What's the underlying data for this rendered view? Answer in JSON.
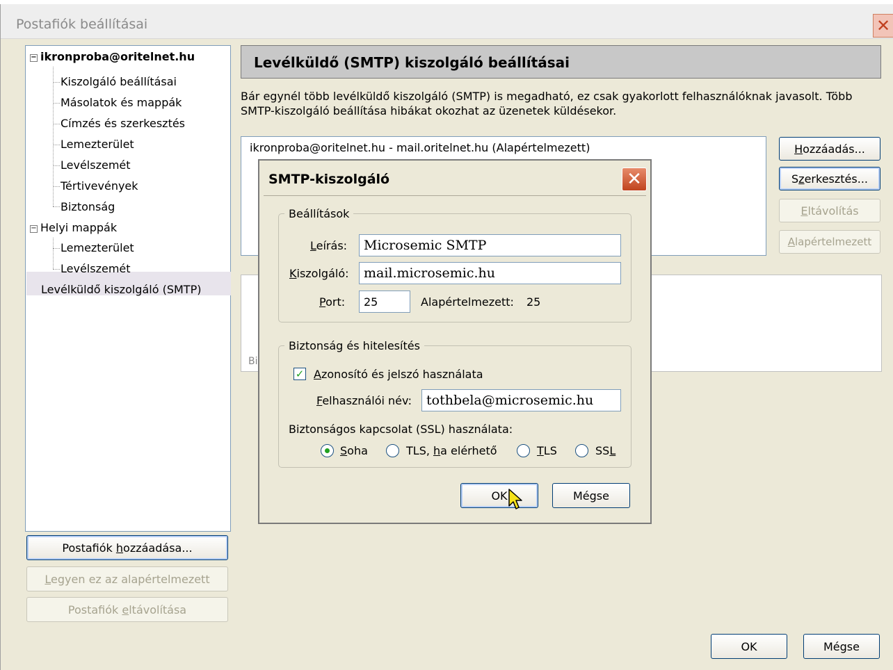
{
  "window": {
    "title": "Postafiók beállításai",
    "close_glyph": "✕"
  },
  "tree": {
    "account1": {
      "label": "ikronproba@oritelnet.hu",
      "items": [
        "Kiszolgáló beállításai",
        "Másolatok és mappák",
        "Címzés és szerkesztés",
        "Lemezterület",
        "Levélszemét",
        "Tértivevények",
        "Biztonság"
      ]
    },
    "account2": {
      "label": "Helyi mappák",
      "items": [
        "Lemezterület",
        "Levélszemét"
      ]
    },
    "smtp_item": "Levélküldő kiszolgáló (SMTP)",
    "expander_glyph": "−"
  },
  "left_buttons": {
    "add_account": {
      "pre": "Postafiók ",
      "key": "h",
      "post": "ozzáadása..."
    },
    "set_default": {
      "pre": "",
      "key": "L",
      "post": "egyen ez az alapértelmezett"
    },
    "remove_account": {
      "pre": "Postafiók ",
      "key": "e",
      "post": "ltávolítása"
    }
  },
  "panel": {
    "heading": "Levélküldő (SMTP) kiszolgáló beállításai",
    "description_line1": "Bár egynél több levélküldő kiszolgáló (SMTP) is megadható, ez csak gyakorlott felhasználóknak javasolt. Több",
    "description_line2": "SMTP-kiszolgáló beállítása hibákat okozhat az üzenetek küldésekor.",
    "server_row": "ikronproba@oritelnet.hu - mail.oritelnet.hu (Alapértelmezett)",
    "detail_partial": "Bi",
    "buttons": {
      "add": {
        "pre": "",
        "key": "H",
        "post": "ozzáadás..."
      },
      "edit": {
        "pre": "S",
        "key": "z",
        "post": "erkesztés..."
      },
      "remove": {
        "pre": "",
        "key": "E",
        "post": "ltávolítás"
      },
      "default": {
        "pre": "",
        "key": "A",
        "post": "lapértelmezett"
      }
    }
  },
  "dialog": {
    "title": "SMTP-kiszolgáló",
    "close_glyph": "✕",
    "settings_group": "Beállítások",
    "description_label": {
      "pre": "",
      "key": "L",
      "post": "eírás:"
    },
    "description_value": "Microsemic SMTP",
    "server_label": {
      "pre": "",
      "key": "K",
      "post": "iszolgáló:"
    },
    "server_value": "mail.microsemic.hu",
    "port_label": {
      "pre": "",
      "key": "P",
      "post": "ort:"
    },
    "port_value": "25",
    "default_label": "Alapértelmezett:",
    "default_value": "25",
    "security_group": "Biztonság és hitelesítés",
    "auth_checkbox": {
      "pre": "",
      "key": "A",
      "post": "zonosító és jelszó használata",
      "checked": true
    },
    "check_glyph": "✓",
    "username_label": {
      "pre": "",
      "key": "F",
      "post": "elhasználói név:"
    },
    "username_value": "tothbela@microsemic.hu",
    "ssl_label": "Biztonságos kapcsolat (SSL) használata:",
    "ssl_options": [
      {
        "pre": "",
        "key": "S",
        "post": "oha",
        "selected": true
      },
      {
        "pre": "TLS, ",
        "key": "h",
        "post": "a elérhető",
        "selected": false
      },
      {
        "pre": "",
        "key": "T",
        "post": "LS",
        "selected": false
      },
      {
        "pre": "SS",
        "key": "L",
        "post": "",
        "selected": false
      }
    ],
    "ok_label": "OK",
    "cancel_label": "Mégse"
  },
  "footer": {
    "ok_label": "OK",
    "cancel_label": "Mégse"
  },
  "colors": {
    "window_bg": "#ece9d8",
    "button_border": "#003c74",
    "check_green": "#21a121",
    "close_red": "#c0441e"
  }
}
